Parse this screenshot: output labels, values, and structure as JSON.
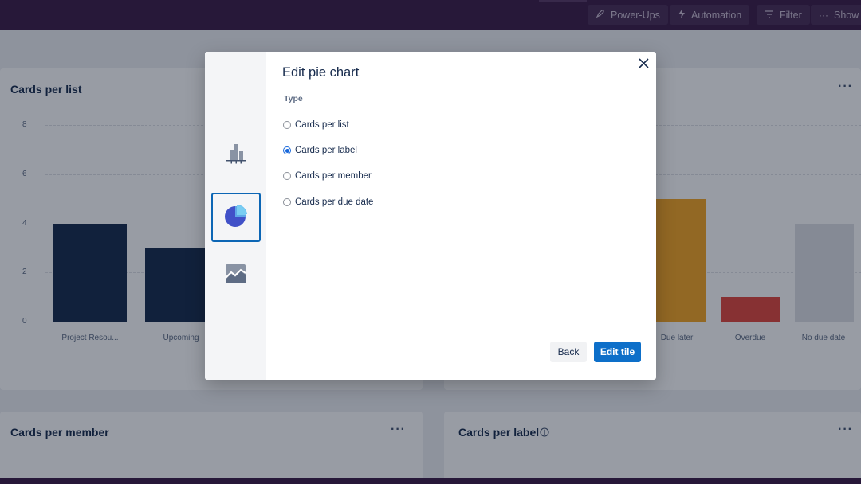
{
  "topbar": {
    "buttons": [
      {
        "label": "Power-Ups",
        "icon": "rocket-icon"
      },
      {
        "label": "Automation",
        "icon": "lightning-icon"
      },
      {
        "label": "Filter",
        "icon": "filter-icon"
      },
      {
        "label": "Show m",
        "icon": "more-icon"
      }
    ],
    "colors": {
      "background": "#3d1d48"
    }
  },
  "board": {
    "tiles": [
      {
        "title": "Cards per list",
        "menu": "···"
      },
      {
        "title": "",
        "menu": "···"
      },
      {
        "title": "Cards per member",
        "menu": "···"
      },
      {
        "title": "Cards per label",
        "menu": "···",
        "info_icon": "info-icon"
      }
    ]
  },
  "chart_data": [
    {
      "type": "bar",
      "title": "Cards per list",
      "categories": [
        "Project Resou...",
        "Upcoming"
      ],
      "values": [
        4,
        3
      ],
      "ylim": [
        0,
        8
      ],
      "yticks": [
        "0",
        "2",
        "4",
        "6",
        "8"
      ],
      "colors": [
        "#172b4d",
        "#172b4d"
      ]
    },
    {
      "type": "bar",
      "categories": [
        "Due later",
        "Overdue",
        "No due date"
      ],
      "values": [
        5,
        1,
        4
      ],
      "ylim": [
        0,
        8
      ],
      "colors": [
        "#f5a623",
        "#e2483d",
        "#dfe1e6"
      ]
    }
  ],
  "modal": {
    "title": "Edit pie chart",
    "type_label": "Type",
    "chart_options": [
      {
        "name": "bar-chart-icon",
        "selected": false
      },
      {
        "name": "pie-chart-icon",
        "selected": true
      },
      {
        "name": "line-chart-icon",
        "selected": false
      }
    ],
    "options": [
      {
        "label": "Cards per list",
        "checked": false
      },
      {
        "label": "Cards per label",
        "checked": true
      },
      {
        "label": "Cards per member",
        "checked": false
      },
      {
        "label": "Cards per due date",
        "checked": false
      }
    ],
    "back_label": "Back",
    "edit_label": "Edit tile",
    "accent": "#0d6fc9"
  }
}
